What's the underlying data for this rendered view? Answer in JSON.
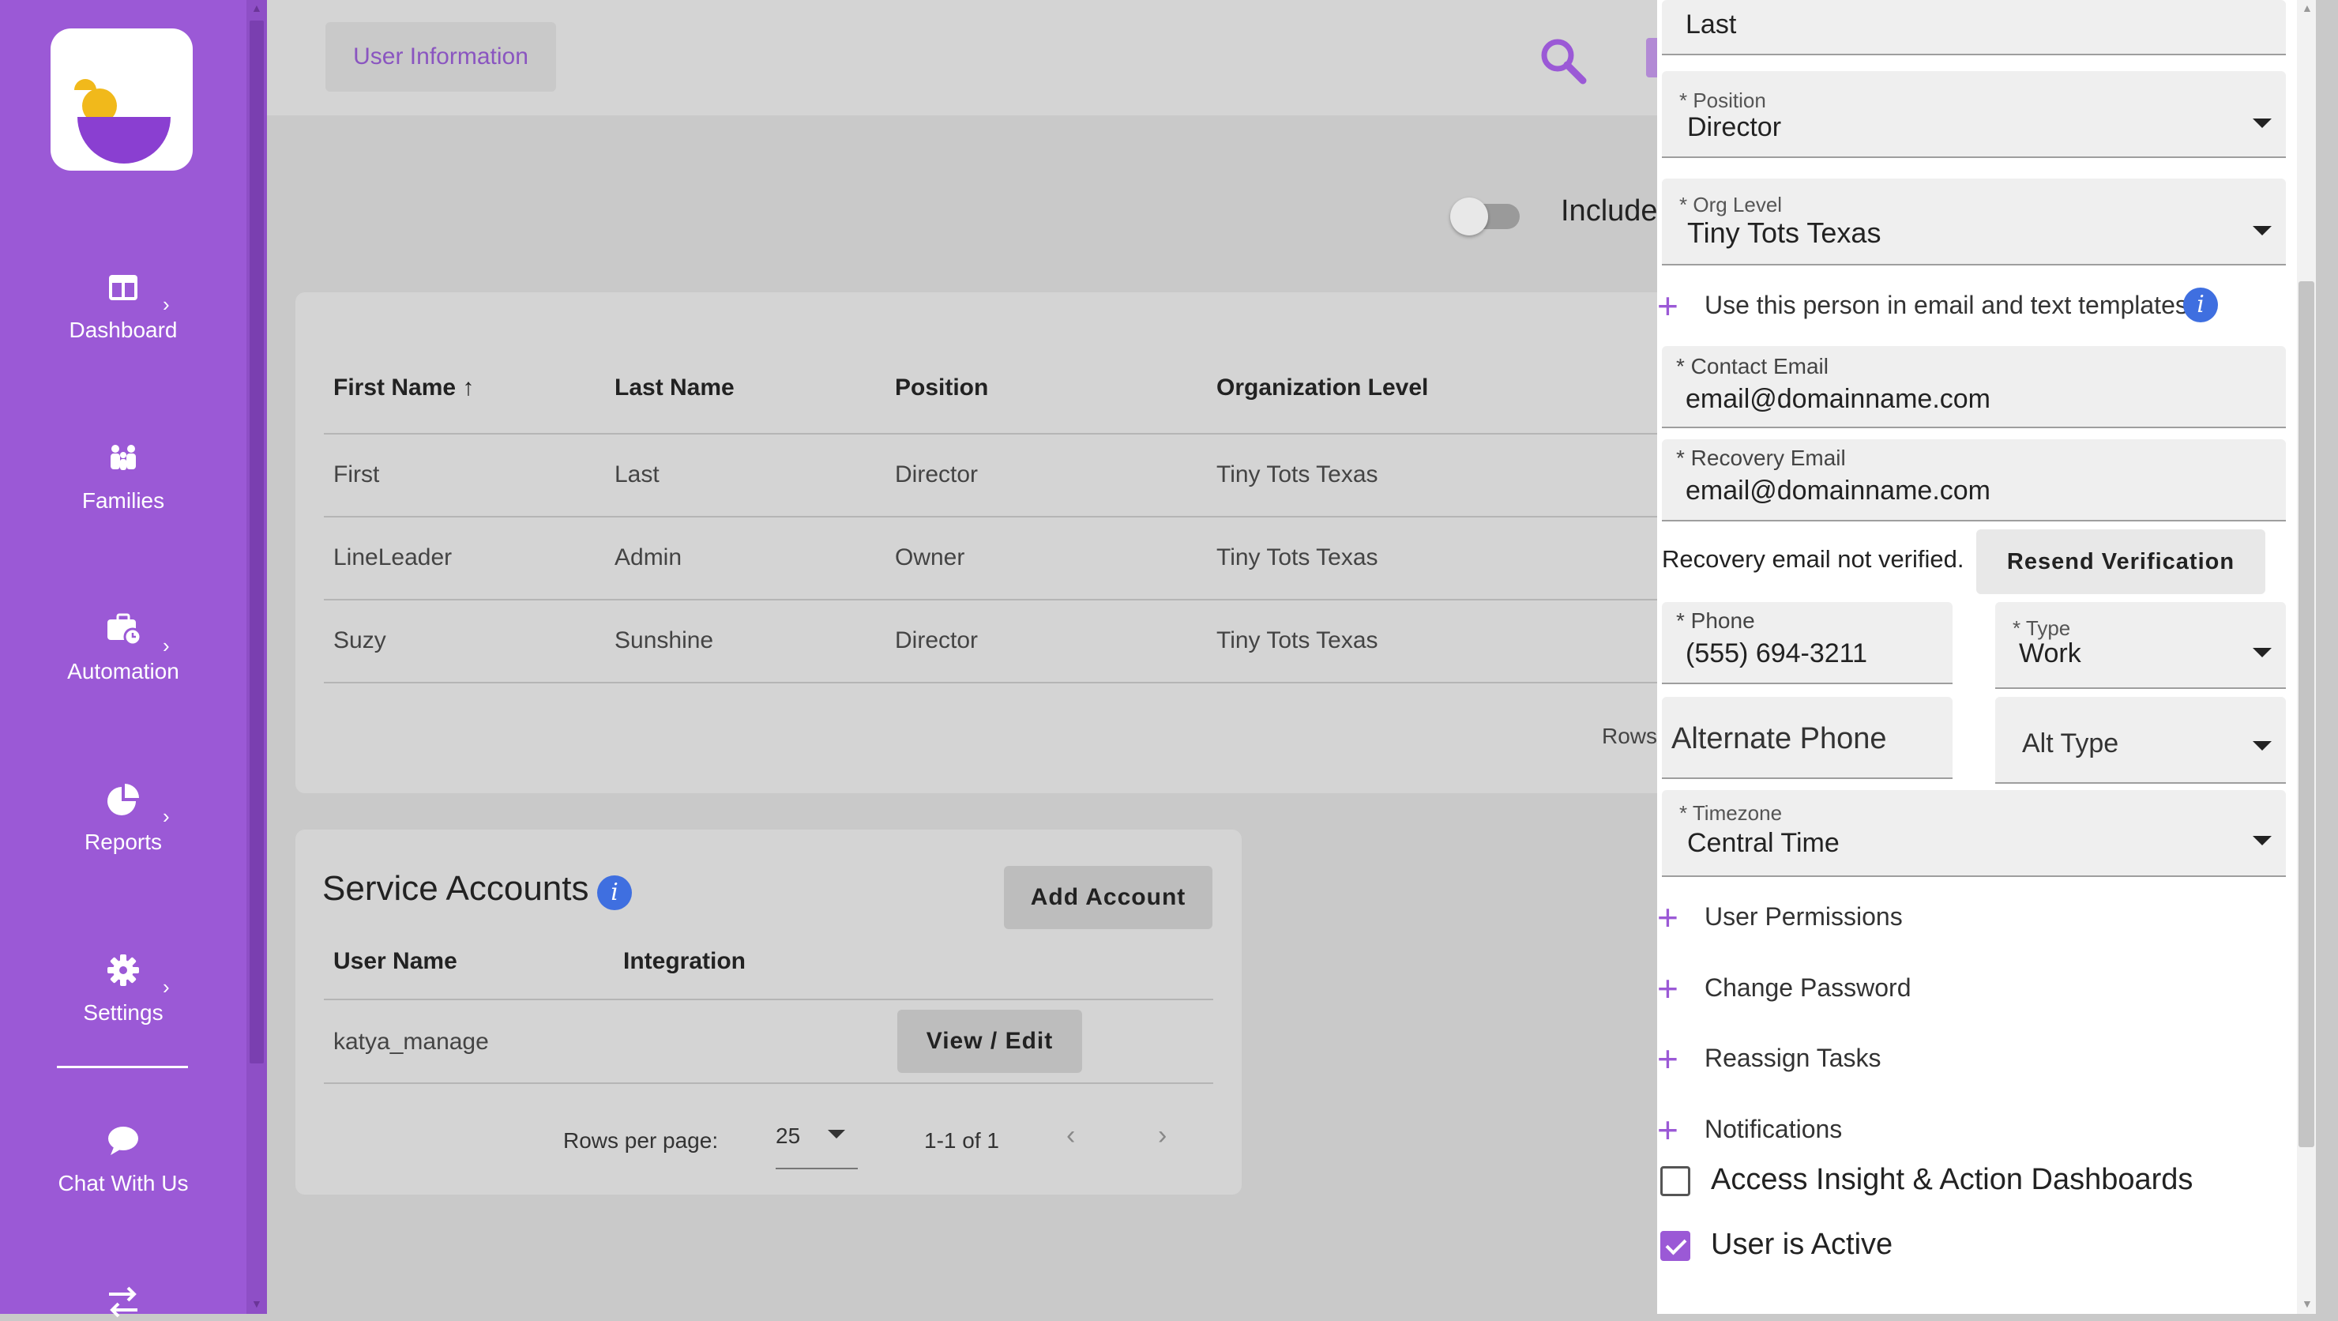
{
  "sidebar": {
    "items": [
      {
        "label": "Dashboard",
        "icon": "dashboard-icon"
      },
      {
        "label": "Families",
        "icon": "families-icon"
      },
      {
        "label": "Automation",
        "icon": "briefcase-clock-icon"
      },
      {
        "label": "Reports",
        "icon": "pie-chart-icon"
      },
      {
        "label": "Settings",
        "icon": "gear-icon"
      },
      {
        "label": "Chat With Us",
        "icon": "chat-bubble-icon"
      }
    ]
  },
  "header": {
    "tab_label": "User Information",
    "include_label": "Include"
  },
  "users_table": {
    "headers": [
      "First Name",
      "Last Name",
      "Position",
      "Organization Level"
    ],
    "sort_indicator": "↑",
    "rows": [
      [
        "First",
        "Last",
        "Director",
        "Tiny Tots Texas"
      ],
      [
        "LineLeader",
        "Admin",
        "Owner",
        "Tiny Tots Texas"
      ],
      [
        "Suzy",
        "Sunshine",
        "Director",
        "Tiny Tots Texas"
      ]
    ],
    "rows_label": "Rows"
  },
  "service_accounts": {
    "title": "Service Accounts",
    "add_button": "Add Account",
    "headers": [
      "User Name",
      "Integration"
    ],
    "rows": [
      {
        "user_name": "katya_manage",
        "integration": "",
        "action": "View / Edit"
      }
    ],
    "rows_per_page_label": "Rows per page:",
    "rows_per_page_value": "25",
    "range": "1-1 of 1"
  },
  "drawer": {
    "last_name_value": "Last",
    "position": {
      "label": "* Position",
      "value": "Director"
    },
    "org_level": {
      "label": "* Org Level",
      "value": "Tiny Tots Texas"
    },
    "use_in_templates": "Use this person in email and text templates.",
    "contact_email": {
      "label": "* Contact Email",
      "value": "email@domainname.com"
    },
    "recovery_email": {
      "label": "* Recovery Email",
      "value": "email@domainname.com"
    },
    "recovery_status": "Recovery email not verified.",
    "resend_button": "Resend Verification",
    "phone": {
      "label": "* Phone",
      "value": "(555) 694-3211"
    },
    "type": {
      "label": "* Type",
      "value": "Work"
    },
    "alt_phone_placeholder": "Alternate Phone",
    "alt_type_placeholder": "Alt Type",
    "timezone": {
      "label": "* Timezone",
      "value": "Central Time"
    },
    "sections": [
      "User Permissions",
      "Change Password",
      "Reassign Tasks",
      "Notifications"
    ],
    "checkboxes": [
      {
        "label": "Access Insight & Action Dashboards",
        "checked": false
      },
      {
        "label": "User is Active",
        "checked": true
      }
    ]
  },
  "colors": {
    "brand_purple": "#9b59d6",
    "info_blue": "#3f6fe0",
    "overlay_grey": "#c9c9c9"
  }
}
